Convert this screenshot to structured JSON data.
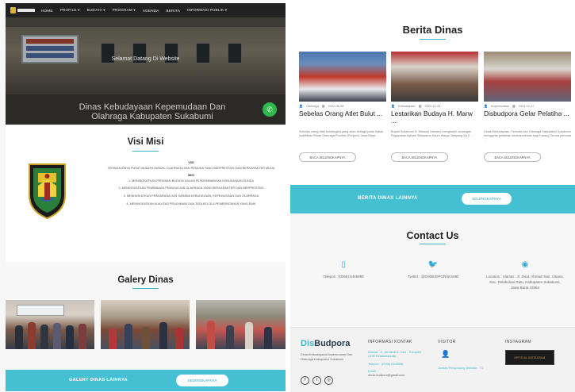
{
  "nav": {
    "items": [
      "HOME",
      "PROFILE ▾",
      "BUDAYA ▾",
      "PROGRAM ▾",
      "AGENDA",
      "BERITA",
      "INFORMASI PUBLIK ▾"
    ]
  },
  "hero": {
    "welcome": "Selamat Datang Di Website",
    "title": "Dinas Kebudayaan Kepemudaan Dan Olahraga Kabupaten Sukabumi"
  },
  "visi_misi": {
    "heading": "Visi Misi",
    "visi_label": "VISI",
    "visi_text": "TERWUJUDNYA PUSAT BUDAYA SUNDA, OLAHRAGA DAN PEMUDA YANG BERPRESTASI DAN BERKARAKTER MULIA",
    "misi_label": "MISI",
    "misi": [
      "1. MENINGKATKAN PERANAN BUDAYA DALAM PENGEMBANGAN KEBUDAYAAN SUNDA",
      "2. MENINGKATKAN PEMBINAAN PEMUDA DAN OLAHRAGA YANG BERKARAKTER DAN BERPRESTASI",
      "3. MENINGKATKAN PRASARANA DAN SARANA KEBUDAYAAN, KEPEMUDAAN DAN OLAHRAGA",
      "4. MENINGKATKAN KUALITAS PELAYANAN DAN TATA KELOLA PEMERINTAHAN YANG BAIK"
    ]
  },
  "galery": {
    "heading": "Galery Dinas",
    "bar_label": "GALERY DINAS LAINNYA",
    "bar_button": "SELENGKAPNYA"
  },
  "berita": {
    "heading": "Berita Dinas",
    "cards": [
      {
        "author": "Olahraga",
        "date": "2022-06-08",
        "title": "Sebelas Orang Atlet Bulut ...",
        "excerpt": "Sebelas orang atlet bulutangkis yang akan berlaga pada babak kualifikasi Pekan Olahraga Provinsi (Porprov) Jawa Barat ...",
        "more": "BACA SELENGKAPNYA"
      },
      {
        "author": "Kebudayaan",
        "date": "2021-12-31",
        "title": "Lestarikan Budaya H. Marw ...",
        "excerpt": "Bupati Sukabumi H. Marwan Hamami menghadiri undangan Paguyuban Ajeuan Sikawarna Kaum Warga Jampang Ke 2 ...",
        "more": "BACA SELENGKAPNYA"
      },
      {
        "author": "Kepemudaan",
        "date": "2021-12-17",
        "title": "Disbudpora Gelar Pelatiha ...",
        "excerpt": "Dinas Kebudayaan, Pemuda dan Olahraga Kabupaten Sukabumi menggelar pelatihan kewirausahaan bagi Karang Taruna pemuda ...",
        "more": "BACA SELENGKAPNYA"
      }
    ],
    "bar_label": "BERITA DINAS LAINNYA",
    "bar_button": "SELENGKAPNYA"
  },
  "contact": {
    "heading": "Contact Us",
    "phone": "Telepon : (0266) 6446998",
    "twitter": "Twitter : @DISBUDPORAKSMB",
    "location": "Location : Alamat : Jl. Jend. Ahmad Yani, Cikaso, Kec. Pelabuhan Ratu, Kabupaten Sukabumi, Jawa Barat 43364"
  },
  "footer": {
    "brand_a": "Dis",
    "brand_b": "Budpora",
    "about": "Dinas Kebudayaan Kepemudaan Dan Olahraga Kabupaten Sukabumi",
    "info_heading": "INFORMASI KONTAK",
    "alamat": "Alamat : Jl. Jenderal A. Yani - Komplek GOR Palabuhanratu",
    "telepon": "Telepon : (0266) 6446998",
    "email_label": "Email :",
    "email": "dinas.budpora@gmail.com",
    "visitor_heading": "VISITOR",
    "visitor_text": "Jumlah Pengunjung Website : 71",
    "instagram_heading": "INSTAGRAM",
    "instagram_caption": "OFFICIAL INSTAGRAM"
  }
}
